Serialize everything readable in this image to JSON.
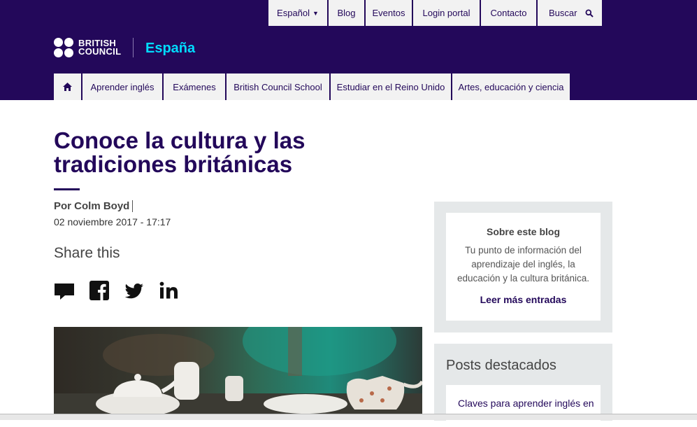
{
  "top_links": [
    {
      "label": "Español",
      "has_caret": true
    },
    {
      "label": "Blog"
    },
    {
      "label": "Eventos"
    },
    {
      "label": "Login portal"
    },
    {
      "label": "Contacto"
    },
    {
      "label": "Buscar"
    }
  ],
  "site": {
    "logo_line1": "BRITISH",
    "logo_line2": "COUNCIL",
    "name": "España"
  },
  "nav": {
    "items": [
      {
        "label": "Aprender inglés"
      },
      {
        "label": "Exámenes"
      },
      {
        "label": "British Council School"
      },
      {
        "label": "Estudiar en el Reino Unido"
      },
      {
        "label": "Artes, educación y ciencia"
      }
    ]
  },
  "article": {
    "title": "Conoce la cultura y las tradiciones británicas",
    "author": "Por Colm Boyd",
    "date": "02 noviembre 2017 - 17:17",
    "share_heading": "Share this"
  },
  "sidebar": {
    "about_title": "Sobre este blog",
    "about_text": "Tu punto de información del aprendizaje del inglés, la educación y la cultura británica.",
    "about_link": "Leer más entradas",
    "featured_title": "Posts destacados",
    "featured_first": "Claves para aprender inglés en"
  },
  "colors": {
    "brand_purple": "#23085a",
    "accent_cyan": "#00dcff",
    "sidebar_grey": "#e5e8e9"
  }
}
